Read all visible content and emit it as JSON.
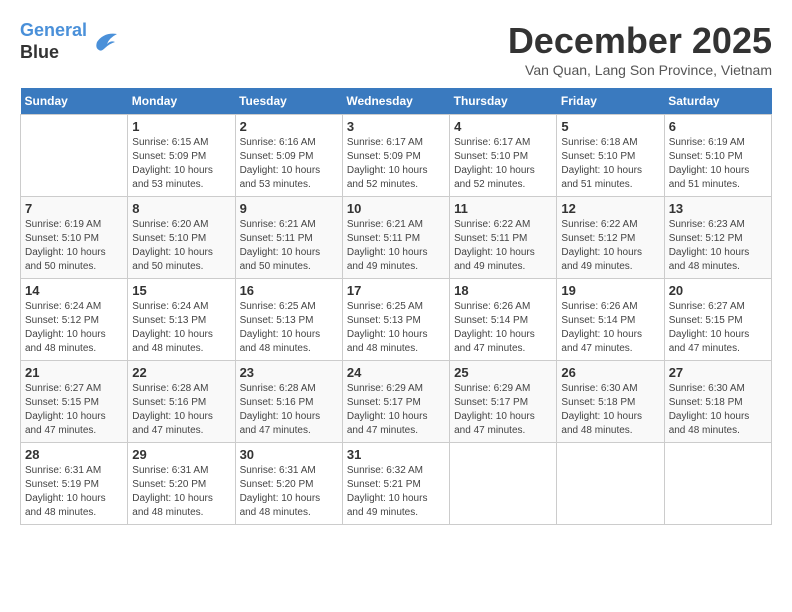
{
  "logo": {
    "line1": "General",
    "line2": "Blue"
  },
  "title": "December 2025",
  "location": "Van Quan, Lang Son Province, Vietnam",
  "days_of_week": [
    "Sunday",
    "Monday",
    "Tuesday",
    "Wednesday",
    "Thursday",
    "Friday",
    "Saturday"
  ],
  "weeks": [
    [
      {
        "day": "",
        "info": ""
      },
      {
        "day": "1",
        "info": "Sunrise: 6:15 AM\nSunset: 5:09 PM\nDaylight: 10 hours\nand 53 minutes."
      },
      {
        "day": "2",
        "info": "Sunrise: 6:16 AM\nSunset: 5:09 PM\nDaylight: 10 hours\nand 53 minutes."
      },
      {
        "day": "3",
        "info": "Sunrise: 6:17 AM\nSunset: 5:09 PM\nDaylight: 10 hours\nand 52 minutes."
      },
      {
        "day": "4",
        "info": "Sunrise: 6:17 AM\nSunset: 5:10 PM\nDaylight: 10 hours\nand 52 minutes."
      },
      {
        "day": "5",
        "info": "Sunrise: 6:18 AM\nSunset: 5:10 PM\nDaylight: 10 hours\nand 51 minutes."
      },
      {
        "day": "6",
        "info": "Sunrise: 6:19 AM\nSunset: 5:10 PM\nDaylight: 10 hours\nand 51 minutes."
      }
    ],
    [
      {
        "day": "7",
        "info": "Sunrise: 6:19 AM\nSunset: 5:10 PM\nDaylight: 10 hours\nand 50 minutes."
      },
      {
        "day": "8",
        "info": "Sunrise: 6:20 AM\nSunset: 5:10 PM\nDaylight: 10 hours\nand 50 minutes."
      },
      {
        "day": "9",
        "info": "Sunrise: 6:21 AM\nSunset: 5:11 PM\nDaylight: 10 hours\nand 50 minutes."
      },
      {
        "day": "10",
        "info": "Sunrise: 6:21 AM\nSunset: 5:11 PM\nDaylight: 10 hours\nand 49 minutes."
      },
      {
        "day": "11",
        "info": "Sunrise: 6:22 AM\nSunset: 5:11 PM\nDaylight: 10 hours\nand 49 minutes."
      },
      {
        "day": "12",
        "info": "Sunrise: 6:22 AM\nSunset: 5:12 PM\nDaylight: 10 hours\nand 49 minutes."
      },
      {
        "day": "13",
        "info": "Sunrise: 6:23 AM\nSunset: 5:12 PM\nDaylight: 10 hours\nand 48 minutes."
      }
    ],
    [
      {
        "day": "14",
        "info": "Sunrise: 6:24 AM\nSunset: 5:12 PM\nDaylight: 10 hours\nand 48 minutes."
      },
      {
        "day": "15",
        "info": "Sunrise: 6:24 AM\nSunset: 5:13 PM\nDaylight: 10 hours\nand 48 minutes."
      },
      {
        "day": "16",
        "info": "Sunrise: 6:25 AM\nSunset: 5:13 PM\nDaylight: 10 hours\nand 48 minutes."
      },
      {
        "day": "17",
        "info": "Sunrise: 6:25 AM\nSunset: 5:13 PM\nDaylight: 10 hours\nand 48 minutes."
      },
      {
        "day": "18",
        "info": "Sunrise: 6:26 AM\nSunset: 5:14 PM\nDaylight: 10 hours\nand 47 minutes."
      },
      {
        "day": "19",
        "info": "Sunrise: 6:26 AM\nSunset: 5:14 PM\nDaylight: 10 hours\nand 47 minutes."
      },
      {
        "day": "20",
        "info": "Sunrise: 6:27 AM\nSunset: 5:15 PM\nDaylight: 10 hours\nand 47 minutes."
      }
    ],
    [
      {
        "day": "21",
        "info": "Sunrise: 6:27 AM\nSunset: 5:15 PM\nDaylight: 10 hours\nand 47 minutes."
      },
      {
        "day": "22",
        "info": "Sunrise: 6:28 AM\nSunset: 5:16 PM\nDaylight: 10 hours\nand 47 minutes."
      },
      {
        "day": "23",
        "info": "Sunrise: 6:28 AM\nSunset: 5:16 PM\nDaylight: 10 hours\nand 47 minutes."
      },
      {
        "day": "24",
        "info": "Sunrise: 6:29 AM\nSunset: 5:17 PM\nDaylight: 10 hours\nand 47 minutes."
      },
      {
        "day": "25",
        "info": "Sunrise: 6:29 AM\nSunset: 5:17 PM\nDaylight: 10 hours\nand 47 minutes."
      },
      {
        "day": "26",
        "info": "Sunrise: 6:30 AM\nSunset: 5:18 PM\nDaylight: 10 hours\nand 48 minutes."
      },
      {
        "day": "27",
        "info": "Sunrise: 6:30 AM\nSunset: 5:18 PM\nDaylight: 10 hours\nand 48 minutes."
      }
    ],
    [
      {
        "day": "28",
        "info": "Sunrise: 6:31 AM\nSunset: 5:19 PM\nDaylight: 10 hours\nand 48 minutes."
      },
      {
        "day": "29",
        "info": "Sunrise: 6:31 AM\nSunset: 5:20 PM\nDaylight: 10 hours\nand 48 minutes."
      },
      {
        "day": "30",
        "info": "Sunrise: 6:31 AM\nSunset: 5:20 PM\nDaylight: 10 hours\nand 48 minutes."
      },
      {
        "day": "31",
        "info": "Sunrise: 6:32 AM\nSunset: 5:21 PM\nDaylight: 10 hours\nand 49 minutes."
      },
      {
        "day": "",
        "info": ""
      },
      {
        "day": "",
        "info": ""
      },
      {
        "day": "",
        "info": ""
      }
    ]
  ]
}
